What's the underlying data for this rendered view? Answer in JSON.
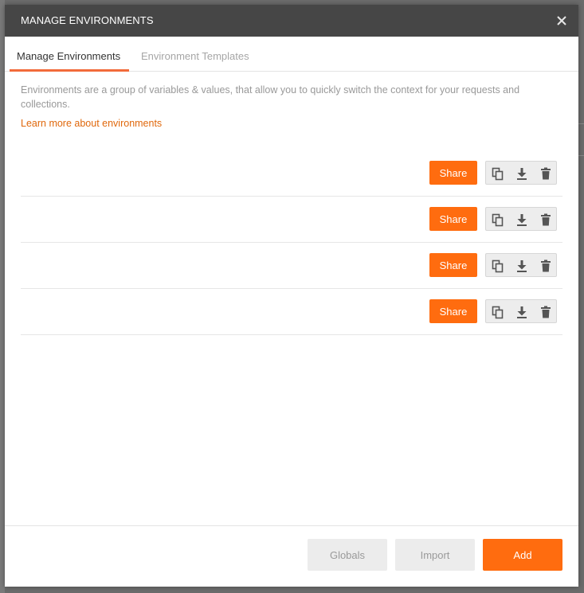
{
  "modal": {
    "title": "MANAGE ENVIRONMENTS",
    "close_icon": "close-icon"
  },
  "tabs": [
    {
      "label": "Manage Environments",
      "active": true
    },
    {
      "label": "Environment Templates",
      "active": false
    }
  ],
  "description": "Environments are a group of variables & values, that allow you to quickly switch the context for your requests and collections.",
  "learn_more_link": "Learn more about environments",
  "environments": [
    {
      "name": "",
      "share_label": "Share"
    },
    {
      "name": "",
      "share_label": "Share"
    },
    {
      "name": "",
      "share_label": "Share"
    },
    {
      "name": "",
      "share_label": "Share"
    }
  ],
  "row_actions": {
    "duplicate_icon": "duplicate-icon",
    "download_icon": "download-icon",
    "delete_icon": "trash-icon"
  },
  "footer": {
    "globals_label": "Globals",
    "import_label": "Import",
    "add_label": "Add"
  },
  "colors": {
    "accent": "#ff6c0f",
    "header_bg": "#464646",
    "link": "#e0680c",
    "tab_underline": "#f26b3a"
  }
}
